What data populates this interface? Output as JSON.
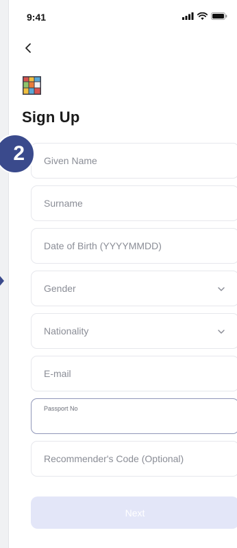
{
  "status": {
    "time": "9:41"
  },
  "header": {
    "title": "Sign Up"
  },
  "step": {
    "number": "2"
  },
  "form": {
    "given_name": "Given Name",
    "surname": "Surname",
    "dob": "Date of Birth (YYYYMMDD)",
    "gender": "Gender",
    "nationality": "Nationality",
    "email": "E-mail",
    "passport": {
      "label": "Passport No",
      "value": ""
    },
    "recommender": "Recommender's Code (Optional)"
  },
  "actions": {
    "next": "Next"
  },
  "colors": {
    "accent": "#3a4a8c",
    "button_disabled": "#e3e6f8",
    "border": "#e6e7ec",
    "placeholder": "#8a8d96"
  }
}
